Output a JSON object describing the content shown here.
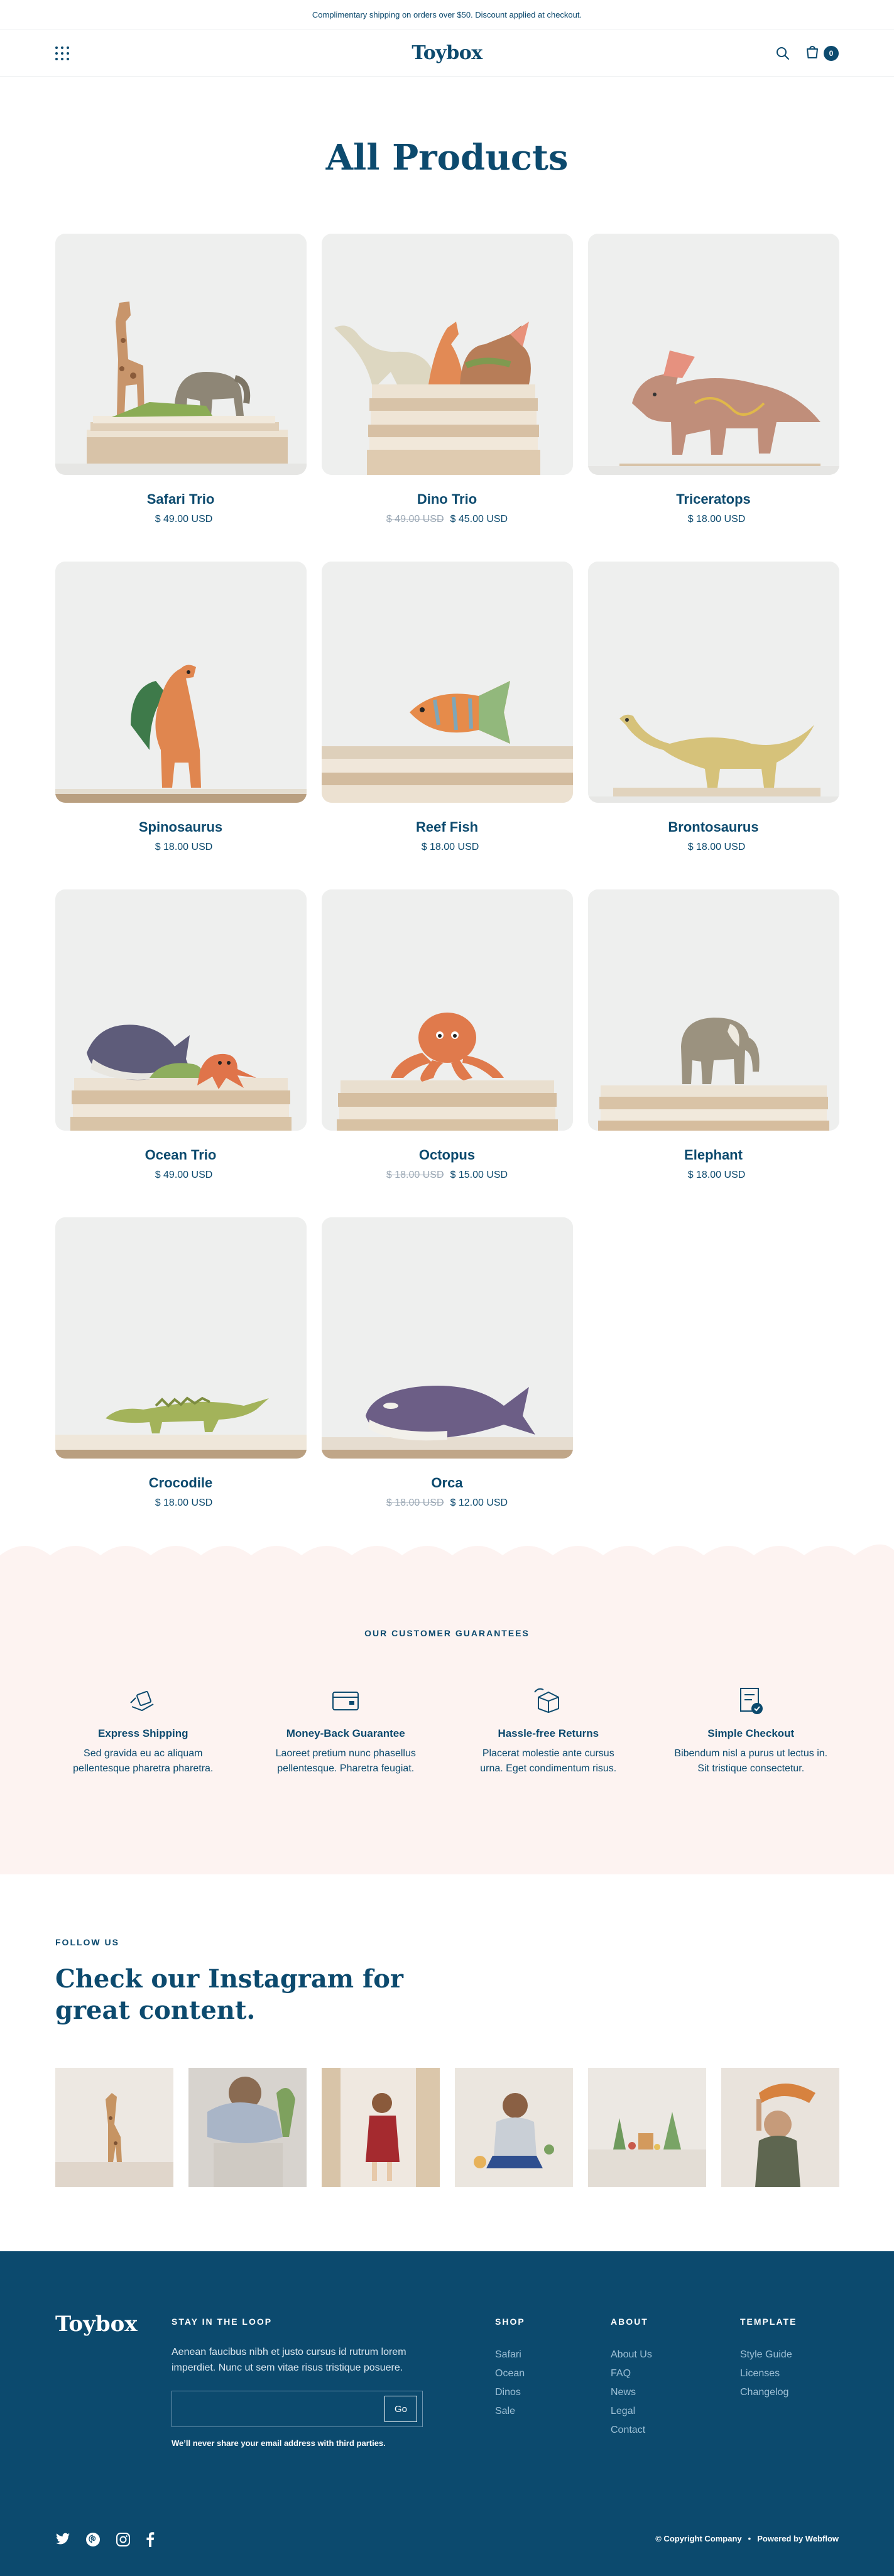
{
  "announcement": "Complimentary shipping on orders over $50. Discount applied at checkout.",
  "nav": {
    "brand": "Toybox",
    "menu_icon": "grid-menu-icon",
    "search_icon": "search-icon",
    "cart_icon": "bag-icon",
    "cart_count": "0"
  },
  "page_title": "All Products",
  "products": [
    {
      "name": "Safari Trio",
      "price": "$ 49.00 USD",
      "old_price": ""
    },
    {
      "name": "Dino Trio",
      "price": "$ 45.00 USD",
      "old_price": "$ 49.00 USD"
    },
    {
      "name": "Triceratops",
      "price": "$ 18.00 USD",
      "old_price": ""
    },
    {
      "name": "Spinosaurus",
      "price": "$ 18.00 USD",
      "old_price": ""
    },
    {
      "name": "Reef Fish",
      "price": "$ 18.00 USD",
      "old_price": ""
    },
    {
      "name": "Brontosaurus",
      "price": "$ 18.00 USD",
      "old_price": ""
    },
    {
      "name": "Ocean Trio",
      "price": "$ 49.00 USD",
      "old_price": ""
    },
    {
      "name": "Octopus",
      "price": "$ 15.00 USD",
      "old_price": "$ 18.00 USD"
    },
    {
      "name": "Elephant",
      "price": "$ 18.00 USD",
      "old_price": ""
    },
    {
      "name": "Crocodile",
      "price": "$ 18.00 USD",
      "old_price": ""
    },
    {
      "name": "Orca",
      "price": "$ 12.00 USD",
      "old_price": "$ 18.00 USD"
    }
  ],
  "guarantees": {
    "title": "OUR CUSTOMER GUARANTEES",
    "items": [
      {
        "name": "Express Shipping",
        "desc": "Sed gravida eu ac aliquam pellentesque pharetra pharetra.",
        "icon": "shipping-icon"
      },
      {
        "name": "Money-Back Guarantee",
        "desc": "Laoreet pretium nunc phasellus pellentesque. Pharetra feugiat.",
        "icon": "wallet-icon"
      },
      {
        "name": "Hassle-free Returns",
        "desc": "Placerat molestie ante cursus urna. Eget condimentum risus.",
        "icon": "return-box-icon"
      },
      {
        "name": "Simple Checkout",
        "desc": "Bibendum nisl a purus ut lectus in. Sit tristique consectetur.",
        "icon": "checkout-icon"
      }
    ]
  },
  "instagram": {
    "eyebrow": "FOLLOW US",
    "title": "Check our Instagram for great content."
  },
  "footer": {
    "brand": "Toybox",
    "loop_heading": "STAY IN THE LOOP",
    "loop_text": "Aenean faucibus nibh et justo cursus id rutrum lorem imperdiet. Nunc ut sem vitae risus tristique posuere.",
    "email_placeholder": "",
    "go_label": "Go",
    "note": "We’ll never share your email address with third parties.",
    "shop": {
      "heading": "SHOP",
      "links": [
        "Safari",
        "Ocean",
        "Dinos",
        "Sale"
      ]
    },
    "about": {
      "heading": "ABOUT",
      "links": [
        "About Us",
        "FAQ",
        "News",
        "Legal",
        "Contact"
      ]
    },
    "template": {
      "heading": "TEMPLATE",
      "links": [
        "Style Guide",
        "Licenses",
        "Changelog"
      ]
    },
    "copyright": "© Copyright Company",
    "powered": "Powered by Webflow",
    "separator": "•"
  },
  "colors": {
    "primary": "#0c4a6e",
    "muted_price": "#9aa7b4",
    "guarantee_bg": "#fdf3f1",
    "footer_bg": "#0c4a6e",
    "footer_link": "#9ec0d6"
  }
}
